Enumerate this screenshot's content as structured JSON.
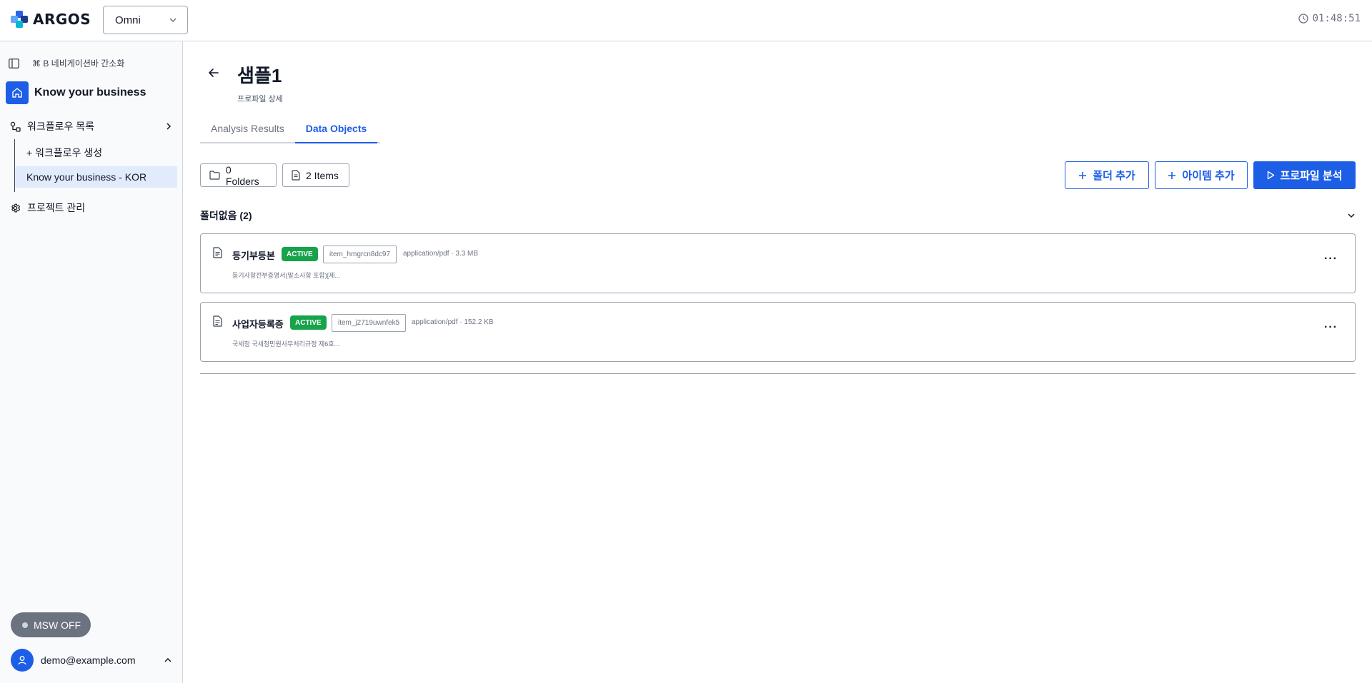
{
  "header": {
    "logo_text": "ARGOS",
    "workspace": "Omni",
    "clock": "01:48:51"
  },
  "sidebar": {
    "shortcut_hint": "⌘ B 네비게이션바 간소화",
    "home_label": "Know your business",
    "workflow_list_label": "워크플로우 목록",
    "workflow_items": [
      {
        "label": "+ 워크플로우 생성"
      },
      {
        "label": "Know your business - KOR"
      }
    ],
    "project_settings_label": "프로젝트 관리",
    "msw_label": "MSW OFF",
    "user_email": "demo@example.com"
  },
  "main": {
    "title": "샘플1",
    "subtitle": "프로파일 상세",
    "tabs": [
      {
        "label": "Analysis Results"
      },
      {
        "label": "Data Objects"
      }
    ],
    "active_tab": "Data Objects",
    "folders_count_label": "0 Folders",
    "items_count_label": "2 Items",
    "buttons": {
      "add_folder": "폴더 추가",
      "add_item": "아이템 추가",
      "analyze_profile": "프로파일 분석"
    },
    "group_title": "폴더없음 (2)",
    "items": [
      {
        "name": "등기부등본",
        "status": "ACTIVE",
        "id": "item_hmgrcn8dc97",
        "meta": "application/pdf · 3.3 MB",
        "description": "등기사항전부증명서(말소사항 포함)[제..."
      },
      {
        "name": "사업자등록증",
        "status": "ACTIVE",
        "id": "item_j2719uwnfek5",
        "meta": "application/pdf · 152.2 KB",
        "description": "국세청 국세청민원사무처리규정 제6호..."
      }
    ]
  },
  "colors": {
    "accent": "#1d5ee6",
    "active_badge": "#16a34a",
    "sidebar_bg": "#f9fafb",
    "selected_item_bg": "#e1ebfb"
  }
}
